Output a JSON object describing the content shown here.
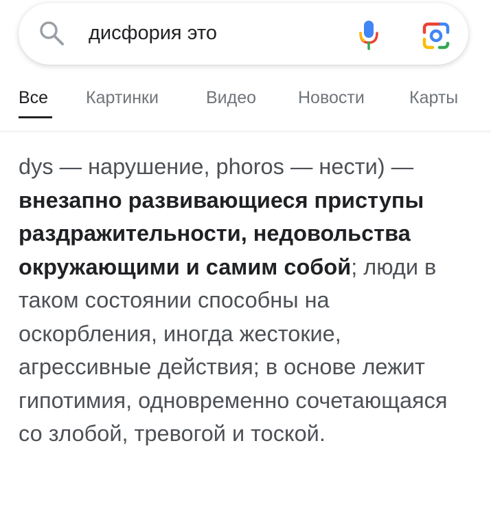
{
  "search": {
    "query": "дисфория это",
    "icons": {
      "left": "search-icon",
      "voice": "mic-icon",
      "lens": "google-lens-icon"
    }
  },
  "tabs": [
    {
      "label": "Все",
      "active": true
    },
    {
      "label": "Картинки",
      "active": false
    },
    {
      "label": "Видео",
      "active": false
    },
    {
      "label": "Новости",
      "active": false
    },
    {
      "label": "Карты",
      "active": false
    }
  ],
  "snippet": {
    "before": "dys — нарушение, phoros — нести) — ",
    "bold": "внезапно развивающиеся приступы раздражительности, недовольства окружающими и самим собой",
    "after": "; люди в таком состоянии способны на оскорбления, иногда жестокие, агрессивные действия; в основе лежит гипотимия, одновременно сочетающаяся со злобой, тревогой и тоской."
  },
  "colors": {
    "google_blue": "#4285f4",
    "google_red": "#ea4335",
    "google_yellow": "#fbbc04",
    "google_green": "#34a853",
    "text_dark": "#202124",
    "text_gray": "#70757a"
  }
}
